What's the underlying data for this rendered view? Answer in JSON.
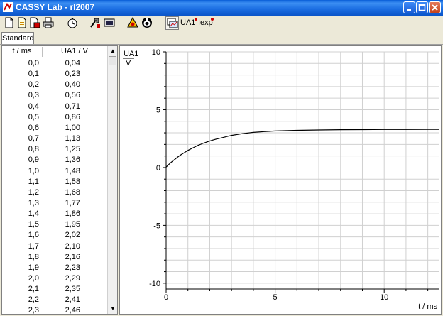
{
  "window": {
    "title": "CASSY Lab - rl2007",
    "icon": "cassy-app-icon"
  },
  "window_controls": [
    "minimize-icon",
    "maximize-icon",
    "close-icon"
  ],
  "toolbar": {
    "buttons": [
      "new-file-icon",
      "open-file-icon",
      "save-file-icon",
      "print-icon",
      "stopwatch-icon",
      "settings-icon",
      "display-icon",
      "measure-icon",
      "clear-icon",
      "table-chart-icon",
      "ua1-icon",
      "iexp-icon"
    ],
    "ua1_text": "UA1",
    "iexp_text": "Iexp"
  },
  "tabs": [
    {
      "label": "Standard",
      "active": true
    }
  ],
  "table": {
    "columns": [
      "t / ms",
      "UA1 / V"
    ],
    "rows": [
      [
        "0,0",
        "0,04"
      ],
      [
        "0,1",
        "0,23"
      ],
      [
        "0,2",
        "0,40"
      ],
      [
        "0,3",
        "0,56"
      ],
      [
        "0,4",
        "0,71"
      ],
      [
        "0,5",
        "0,86"
      ],
      [
        "0,6",
        "1,00"
      ],
      [
        "0,7",
        "1,13"
      ],
      [
        "0,8",
        "1,25"
      ],
      [
        "0,9",
        "1,36"
      ],
      [
        "1,0",
        "1,48"
      ],
      [
        "1,1",
        "1,58"
      ],
      [
        "1,2",
        "1,68"
      ],
      [
        "1,3",
        "1,77"
      ],
      [
        "1,4",
        "1,86"
      ],
      [
        "1,5",
        "1,95"
      ],
      [
        "1,6",
        "2,02"
      ],
      [
        "1,7",
        "2,10"
      ],
      [
        "1,8",
        "2,16"
      ],
      [
        "1,9",
        "2,23"
      ],
      [
        "2,0",
        "2,29"
      ],
      [
        "2,1",
        "2,35"
      ],
      [
        "2,2",
        "2,41"
      ],
      [
        "2,3",
        "2,46"
      ]
    ]
  },
  "chart_data": {
    "type": "line",
    "xlabel": "t / ms",
    "ylabel": "UA1",
    "yunit": "V",
    "xlim": [
      0,
      12.5
    ],
    "ylim": [
      -10.5,
      10
    ],
    "xticks": [
      0,
      5,
      10
    ],
    "yticks": [
      10,
      5,
      0,
      -5,
      -10
    ],
    "grid": true,
    "series": [
      {
        "color": "#000000",
        "x": [
          0,
          0.1,
          0.2,
          0.3,
          0.4,
          0.5,
          0.6,
          0.7,
          0.8,
          0.9,
          1.0,
          1.1,
          1.2,
          1.3,
          1.4,
          1.5,
          1.6,
          1.7,
          1.8,
          1.9,
          2.0,
          2.1,
          2.2,
          2.3,
          2.5,
          3.0,
          3.5,
          4.0,
          4.5,
          5.0,
          6.0,
          7.0,
          8.0,
          9.0,
          10.0,
          11.0,
          12.0,
          12.5
        ],
        "y": [
          0.04,
          0.23,
          0.4,
          0.56,
          0.71,
          0.86,
          1.0,
          1.13,
          1.25,
          1.36,
          1.48,
          1.58,
          1.68,
          1.77,
          1.86,
          1.95,
          2.02,
          2.1,
          2.16,
          2.23,
          2.29,
          2.35,
          2.41,
          2.46,
          2.55,
          2.78,
          2.93,
          3.04,
          3.11,
          3.16,
          3.22,
          3.25,
          3.27,
          3.28,
          3.29,
          3.29,
          3.3,
          3.3
        ]
      }
    ]
  }
}
